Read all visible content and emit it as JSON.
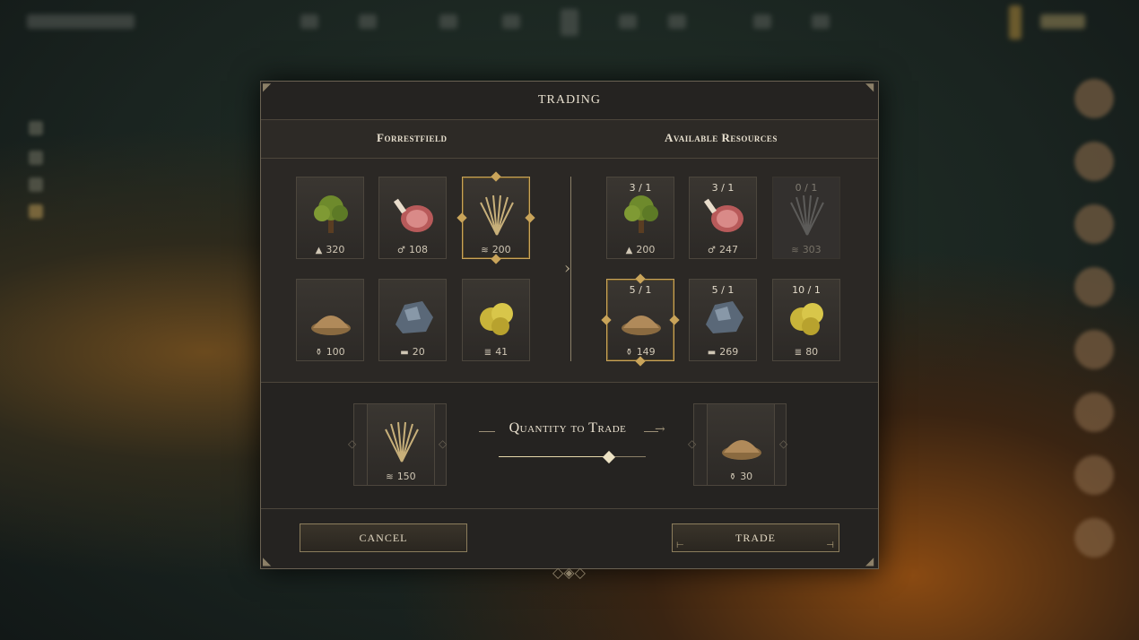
{
  "dialog": {
    "title": "TRADING",
    "left_header": "Forrestfield",
    "right_header": "Available Resources"
  },
  "left_resources": [
    {
      "name": "wood",
      "icon": "tree-icon",
      "amount": "320",
      "selected": false
    },
    {
      "name": "meat",
      "icon": "meat-icon",
      "amount": "108",
      "selected": false
    },
    {
      "name": "wheat",
      "icon": "wheat-icon",
      "amount": "200",
      "selected": true
    },
    {
      "name": "flour",
      "icon": "flour-icon",
      "amount": "100",
      "selected": false
    },
    {
      "name": "iron",
      "icon": "iron-icon",
      "amount": "20",
      "selected": false
    },
    {
      "name": "gold",
      "icon": "gold-icon",
      "amount": "41",
      "selected": false
    }
  ],
  "right_resources": [
    {
      "name": "wood",
      "icon": "tree-icon",
      "ratio": "3 / 1",
      "amount": "200",
      "selected": false,
      "disabled": false
    },
    {
      "name": "meat",
      "icon": "meat-icon",
      "ratio": "3 / 1",
      "amount": "247",
      "selected": false,
      "disabled": false
    },
    {
      "name": "wheat",
      "icon": "wheat-icon",
      "ratio": "0 / 1",
      "amount": "303",
      "selected": false,
      "disabled": true
    },
    {
      "name": "flour",
      "icon": "flour-icon",
      "ratio": "5 / 1",
      "amount": "149",
      "selected": true,
      "disabled": false
    },
    {
      "name": "iron",
      "icon": "iron-icon",
      "ratio": "5 / 1",
      "amount": "269",
      "selected": false,
      "disabled": false
    },
    {
      "name": "gold",
      "icon": "gold-icon",
      "ratio": "10 / 1",
      "amount": "80",
      "selected": false,
      "disabled": false
    }
  ],
  "trade": {
    "label": "Quantity to Trade",
    "give": {
      "icon": "wheat-icon",
      "amount": "150"
    },
    "receive": {
      "icon": "flour-icon",
      "amount": "30"
    },
    "slider_fraction": 0.75
  },
  "buttons": {
    "cancel": "CANCEL",
    "trade": "TRADE"
  },
  "colors": {
    "accent": "#c9a45a",
    "panel": "#252321",
    "text": "#e8e0cf"
  }
}
